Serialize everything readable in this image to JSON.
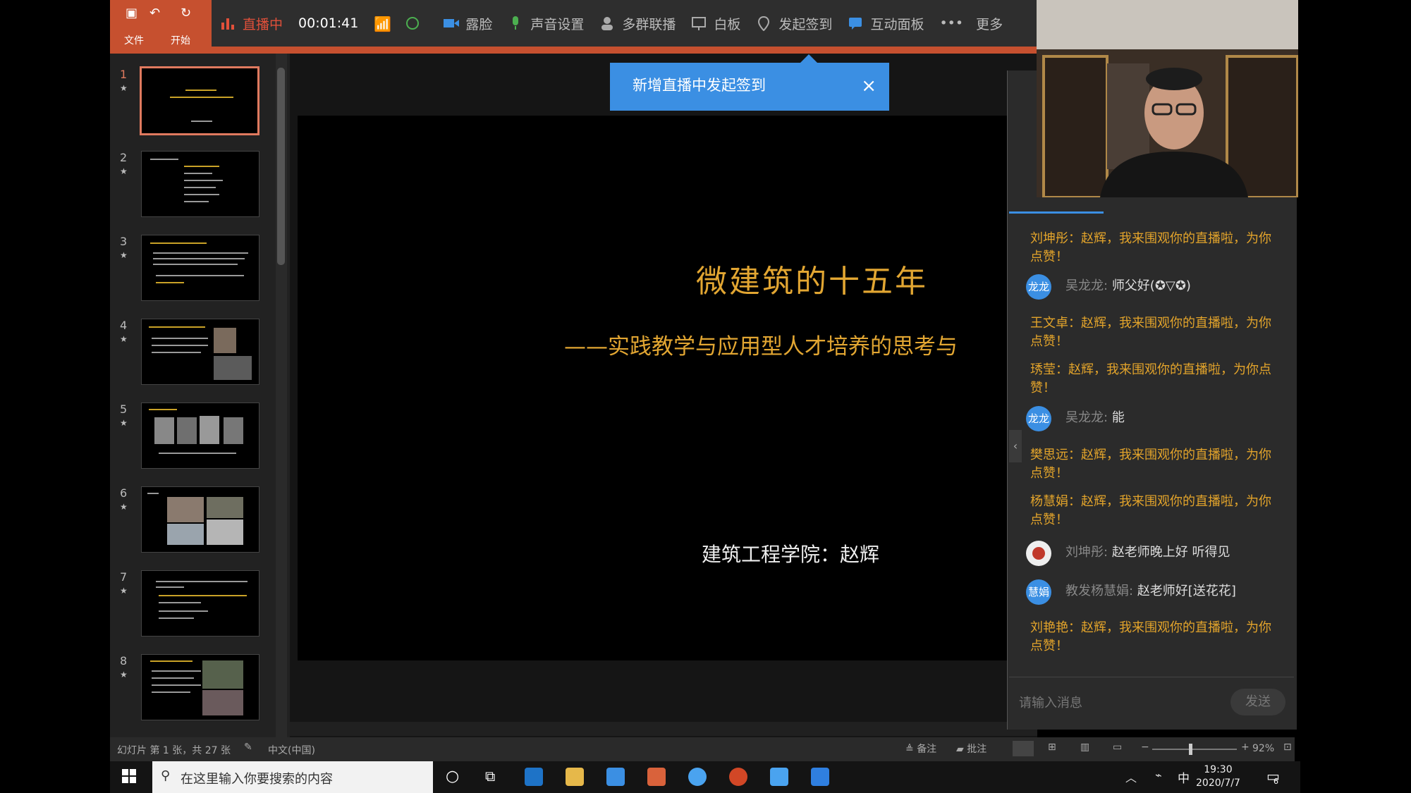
{
  "ppt": {
    "tabs": [
      "文件",
      "开始"
    ]
  },
  "toolbar": {
    "live_label": "直播中",
    "timer": "00:01:41",
    "beauty": "露脸",
    "audio": "声音设置",
    "multi": "多群联播",
    "whiteboard": "白板",
    "checkin": "发起签到",
    "interact": "互动面板",
    "more": "更多"
  },
  "notice": {
    "text": "新增直播中发起签到",
    "close": "×"
  },
  "slides": {
    "numbers": [
      "1",
      "2",
      "3",
      "4",
      "5",
      "6",
      "7",
      "8"
    ],
    "star": "★"
  },
  "slide": {
    "title": "微建筑的十五年",
    "subtitle": "——实践教学与应用型人才培养的思考与",
    "author": "建筑工程学院：赵辉"
  },
  "chat": {
    "messages": [
      {
        "type": "sys",
        "text": "刘坤彤：赵辉，我来围观你的直播啦，为你点赞！"
      },
      {
        "type": "user",
        "avatar": "龙龙",
        "name": "吴龙龙:",
        "text": "师父好(✪▽✪)"
      },
      {
        "type": "sys",
        "text": "王文卓：赵辉，我来围观你的直播啦，为你点赞！"
      },
      {
        "type": "sys",
        "text": "琇莹：赵辉，我来围观你的直播啦，为你点赞！"
      },
      {
        "type": "user",
        "avatar": "龙龙",
        "name": "吴龙龙:",
        "text": "能"
      },
      {
        "type": "sys",
        "text": "樊思远：赵辉，我来围观你的直播啦，为你点赞！"
      },
      {
        "type": "sys",
        "text": "杨慧娟：赵辉，我来围观你的直播啦，为你点赞！"
      },
      {
        "type": "user",
        "avatar": "",
        "name": "刘坤彤:",
        "text": "赵老师晚上好 听得见"
      },
      {
        "type": "user",
        "avatar": "慧娟",
        "name": "教发杨慧娟:",
        "text": "赵老师好[送花花]"
      },
      {
        "type": "sys",
        "text": "刘艳艳：赵辉，我来围观你的直播啦，为你点赞！"
      }
    ],
    "input_placeholder": "请输入消息",
    "send": "发送"
  },
  "status": {
    "slide_info": "幻灯片 第 1 张，共 27 张",
    "language": "中文(中国)",
    "notes": "备注",
    "comments": "批注",
    "zoom": "92%"
  },
  "taskbar": {
    "search": "在这里输入你要搜索的内容",
    "ime": "中",
    "time": "19:30",
    "date": "2020/7/7",
    "notif": "6"
  }
}
